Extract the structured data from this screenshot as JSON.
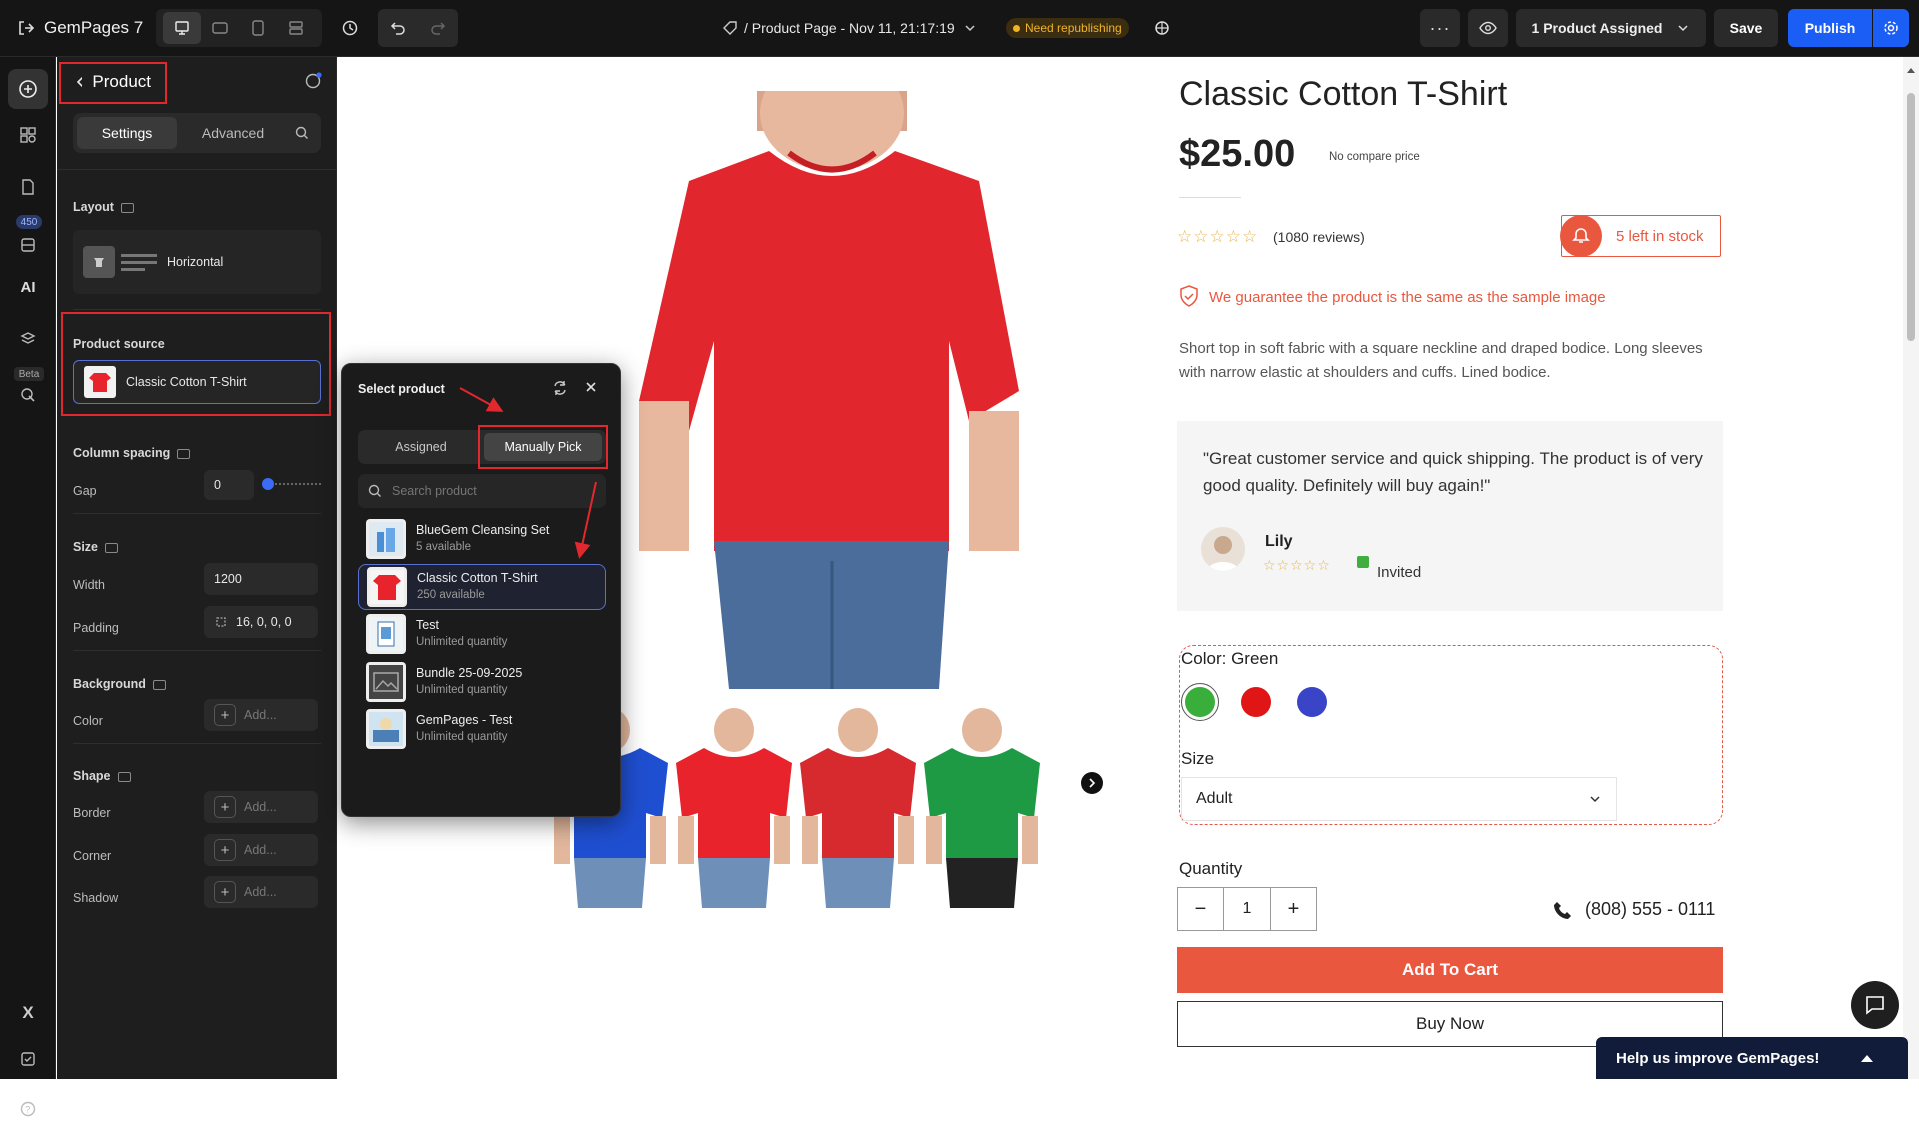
{
  "app": {
    "name": "GemPages",
    "version": "7",
    "page_title": "/ Product Page - Nov 11, 21:17:19",
    "republish_badge": "Need republishing",
    "assigned": "1 Product Assigned",
    "save": "Save",
    "publish": "Publish"
  },
  "rail": {
    "badge": "450",
    "ai": "AI",
    "beta": "Beta"
  },
  "panel": {
    "back_title": "Product",
    "tabs": [
      "Settings",
      "Advanced"
    ],
    "layout": {
      "label": "Layout",
      "value": "Horizontal"
    },
    "product_source": {
      "label": "Product source",
      "value": "Classic Cotton T-Shirt"
    },
    "column_spacing": {
      "label": "Column spacing",
      "gap_label": "Gap",
      "gap_value": "0"
    },
    "size": {
      "label": "Size",
      "width_label": "Width",
      "width_value": "1200",
      "padding_label": "Padding",
      "padding_value": "16, 0, 0, 0"
    },
    "background": {
      "label": "Background",
      "color_label": "Color",
      "add": "Add..."
    },
    "shape": {
      "label": "Shape",
      "border_label": "Border",
      "corner_label": "Corner",
      "shadow_label": "Shadow",
      "add": "Add..."
    }
  },
  "popup": {
    "title": "Select product",
    "tabs": [
      "Assigned",
      "Manually Pick"
    ],
    "search_placeholder": "Search product",
    "items": [
      {
        "name": "BlueGem Cleansing Set",
        "sub": "5 available"
      },
      {
        "name": "Classic Cotton T-Shirt",
        "sub": "250 available"
      },
      {
        "name": "Test",
        "sub": "Unlimited quantity"
      },
      {
        "name": "Bundle 25-09-2025",
        "sub": "Unlimited quantity"
      },
      {
        "name": "GemPages - Test",
        "sub": "Unlimited quantity"
      }
    ]
  },
  "product": {
    "title": "Classic Cotton T-Shirt",
    "price": "$25.00",
    "compare": "No compare price",
    "reviews": "(1080 reviews)",
    "stock": "5 left in stock",
    "guarantee": "We guarantee the product is the same as the sample image",
    "description": "Short top in soft fabric with a square neckline and draped bodice. Long sleeves with narrow elastic at shoulders and cuffs. Lined bodice.",
    "testimonial": "\"Great customer service and quick shipping. The product is of very good quality. Definitely will buy again!\"",
    "reviewer": "Lily",
    "invited": "Invited",
    "color_label": "Color: Green",
    "colors": [
      "#3aae3a",
      "#e01616",
      "#3a44c6"
    ],
    "size_label": "Size",
    "size_value": "Adult",
    "quantity_label": "Quantity",
    "quantity": "1",
    "phone": "(808) 555 - 0111",
    "add_to_cart": "Add To Cart",
    "buy_now": "Buy Now",
    "thumb_colors": [
      "#1f4fd1",
      "#e8232b",
      "#d62a2e",
      "#1f9a44"
    ]
  },
  "feedback": "Help us improve GemPages!"
}
